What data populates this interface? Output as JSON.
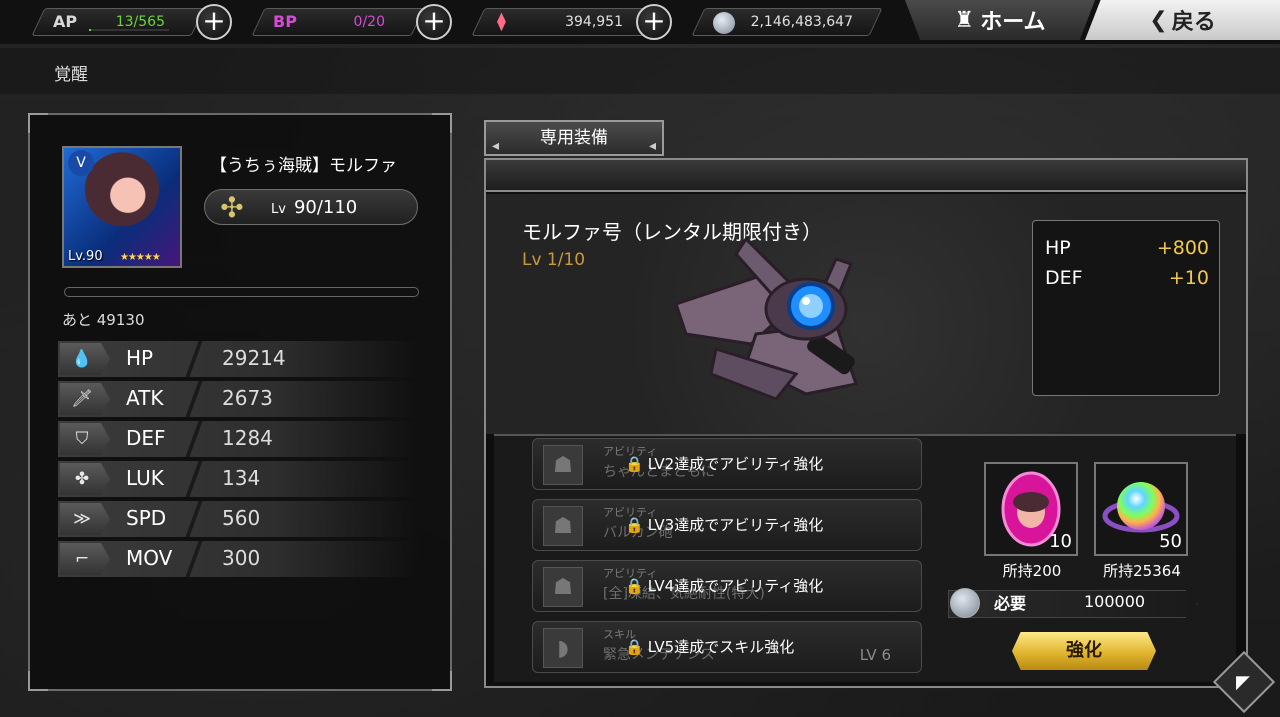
{
  "topbar": {
    "ap": {
      "label": "AP",
      "value": "13/565",
      "fraction": 0.023
    },
    "bp": {
      "label": "BP",
      "value": "0/20",
      "fraction": 0
    },
    "gems": {
      "value": "394,951",
      "icon": "rainbow-crystal-icon"
    },
    "coins": {
      "value": "2,146,483,647",
      "icon": "coin-icon"
    },
    "home_label": "ホーム",
    "back_label": "戻る",
    "colors": {
      "ap": "#6cd33b",
      "bp": "#d64bd6",
      "gems": "#ffffff"
    }
  },
  "page_title": "覚醒",
  "character": {
    "name": "【うちぅ海賊】モルファ",
    "portrait_level": "Lv.90",
    "portrait_stars": "★★★★★",
    "level_prefix": "Lv",
    "level": "90/110",
    "exp_fraction": 0,
    "exp_remaining": "あと 49130",
    "stats": [
      {
        "icon": "drop-icon",
        "glyph": "💧",
        "label": "HP",
        "value": "29214"
      },
      {
        "icon": "sword-icon",
        "glyph": "🗡",
        "label": "ATK",
        "value": "2673"
      },
      {
        "icon": "shield-icon",
        "glyph": "⛉",
        "label": "DEF",
        "value": "1284"
      },
      {
        "icon": "clover-icon",
        "glyph": "✤",
        "label": "LUK",
        "value": "134"
      },
      {
        "icon": "speed-icon",
        "glyph": "≫",
        "label": "SPD",
        "value": "560"
      },
      {
        "icon": "boot-icon",
        "glyph": "⌐",
        "label": "MOV",
        "value": "300"
      }
    ]
  },
  "equipment": {
    "tab_label": "専用装備",
    "name": "モルファ号（レンタル期限付き）",
    "level": "Lv  1/10",
    "bonuses": [
      {
        "label": "HP",
        "value": "+800"
      },
      {
        "label": "DEF",
        "value": "+10"
      }
    ]
  },
  "abilities": [
    {
      "tag": "アビリティ",
      "name": "ちゃんとまともに",
      "lock_text": "LV2達成でアビリティ強化",
      "lv": ""
    },
    {
      "tag": "アビリティ",
      "name": "バルカン砲",
      "lock_text": "LV3達成でアビリティ強化",
      "lv": ""
    },
    {
      "tag": "アビリティ",
      "name": "[全]凍結、気絶耐性(特大)",
      "lock_text": "LV4達成でアビリティ強化",
      "lv": ""
    },
    {
      "tag": "スキル",
      "name": "緊急メンテナンス",
      "lock_text": "LV5達成でスキル強化",
      "lv": "LV 6"
    }
  ],
  "materials": [
    {
      "icon": "pink-egg-gem-icon",
      "count": "10",
      "owned": "所持200"
    },
    {
      "icon": "rainbow-orb-icon",
      "count": "50",
      "owned": "所持25364"
    }
  ],
  "requirement": {
    "label": "必要",
    "value": "100000"
  },
  "enhance_label": "強化"
}
